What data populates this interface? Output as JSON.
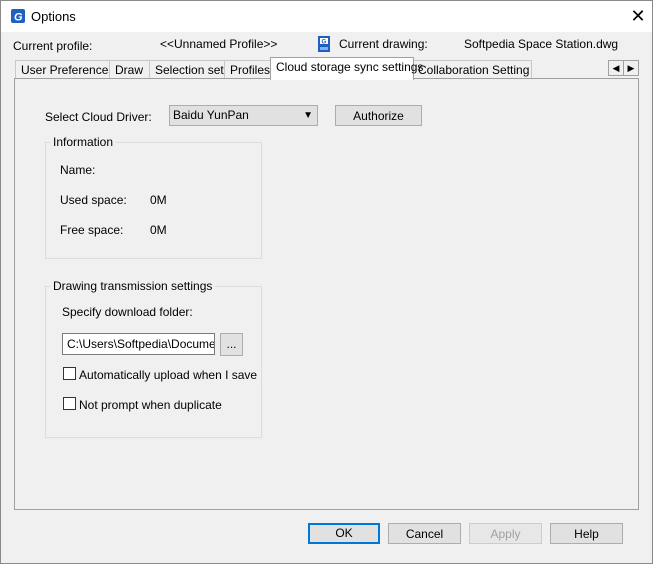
{
  "window": {
    "title": "Options",
    "app_icon": "gstarcad-icon",
    "close_glyph": "✕"
  },
  "profile_row": {
    "current_profile_label": "Current profile:",
    "current_profile_value": "<<Unnamed Profile>>",
    "drawing_icon": "dwg-file-icon",
    "current_drawing_label": "Current drawing:",
    "current_drawing_value": "Softpedia Space Station.dwg"
  },
  "tabs": [
    {
      "label": "User Preferences"
    },
    {
      "label": "Draw"
    },
    {
      "label": "Selection set"
    },
    {
      "label": "Profiles"
    },
    {
      "label": "Cloud storage sync settings",
      "active": true
    },
    {
      "label": "Collaboration Setting"
    }
  ],
  "tab_scroll": {
    "left": "◀",
    "right": "▶"
  },
  "cloud": {
    "select_driver_label": "Select Cloud Driver:",
    "driver_value": "Baidu YunPan",
    "authorize_label": "Authorize"
  },
  "information": {
    "title": "Information",
    "name_label": "Name:",
    "name_value": "",
    "used_label": "Used space:",
    "used_value": "0M",
    "free_label": "Free space:",
    "free_value": "0M"
  },
  "transmission": {
    "title": "Drawing transmission settings",
    "download_label": "Specify download folder:",
    "folder_value": "C:\\Users\\Softpedia\\Documents",
    "browse_label": "...",
    "auto_upload_label": "Automatically upload when I save",
    "auto_upload_checked": false,
    "no_prompt_label": "Not prompt when duplicate",
    "no_prompt_checked": false
  },
  "buttons": {
    "ok": "OK",
    "cancel": "Cancel",
    "apply": "Apply",
    "help": "Help"
  },
  "colors": {
    "accent": "#0078d7",
    "icon_blue": "#1f5fbf"
  }
}
